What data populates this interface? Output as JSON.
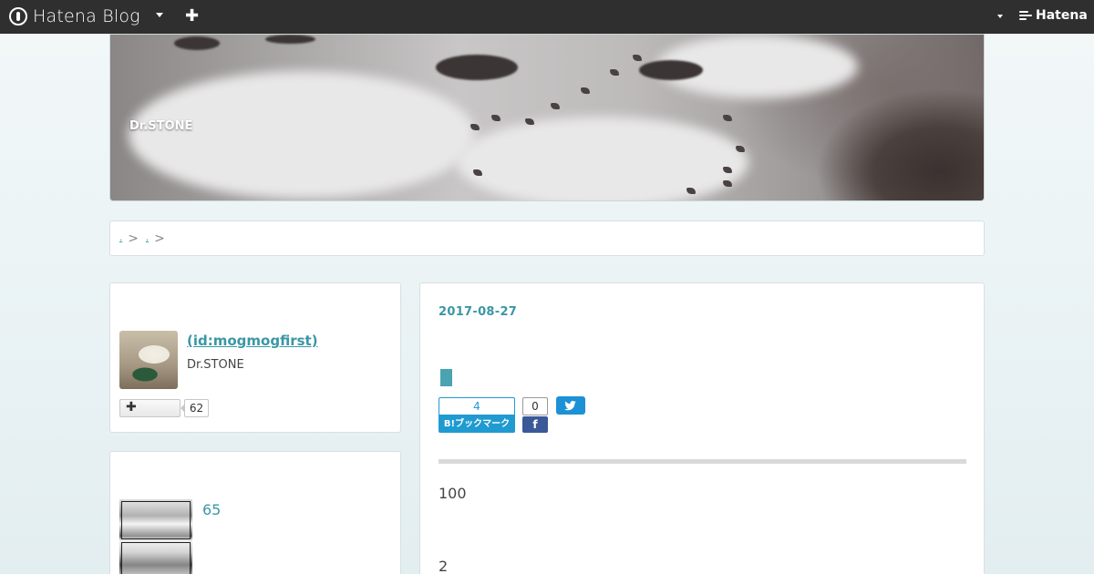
{
  "globalbar": {
    "logo_text": "Hatena Blog",
    "add_icon": "plus-icon",
    "brand_text": "Hatena"
  },
  "header": {
    "blog_title": "Dr.STONE"
  },
  "breadcrumb": {
    "separators": [
      ">",
      ">"
    ]
  },
  "profile": {
    "name": " (id:mogmogfirst)",
    "description": "Dr.STONE",
    "follow_icon": "plus-icon",
    "follow_label": "+",
    "follower_count": "62"
  },
  "module": {
    "count": "65"
  },
  "entry": {
    "date": "2017-08-27",
    "hatena_bookmark": {
      "count": "4",
      "label": "B!ブックマーク"
    },
    "facebook": {
      "count": "0",
      "icon": "facebook-icon"
    },
    "twitter": {
      "icon": "twitter-icon"
    },
    "paragraphs": [
      "100",
      "2"
    ]
  },
  "colors": {
    "accent": "#3a97a6",
    "globalbar": "#2f2f2f",
    "hatena_bookmark": "#1f9bd1",
    "facebook": "#3b5998",
    "twitter": "#1d91d5"
  }
}
